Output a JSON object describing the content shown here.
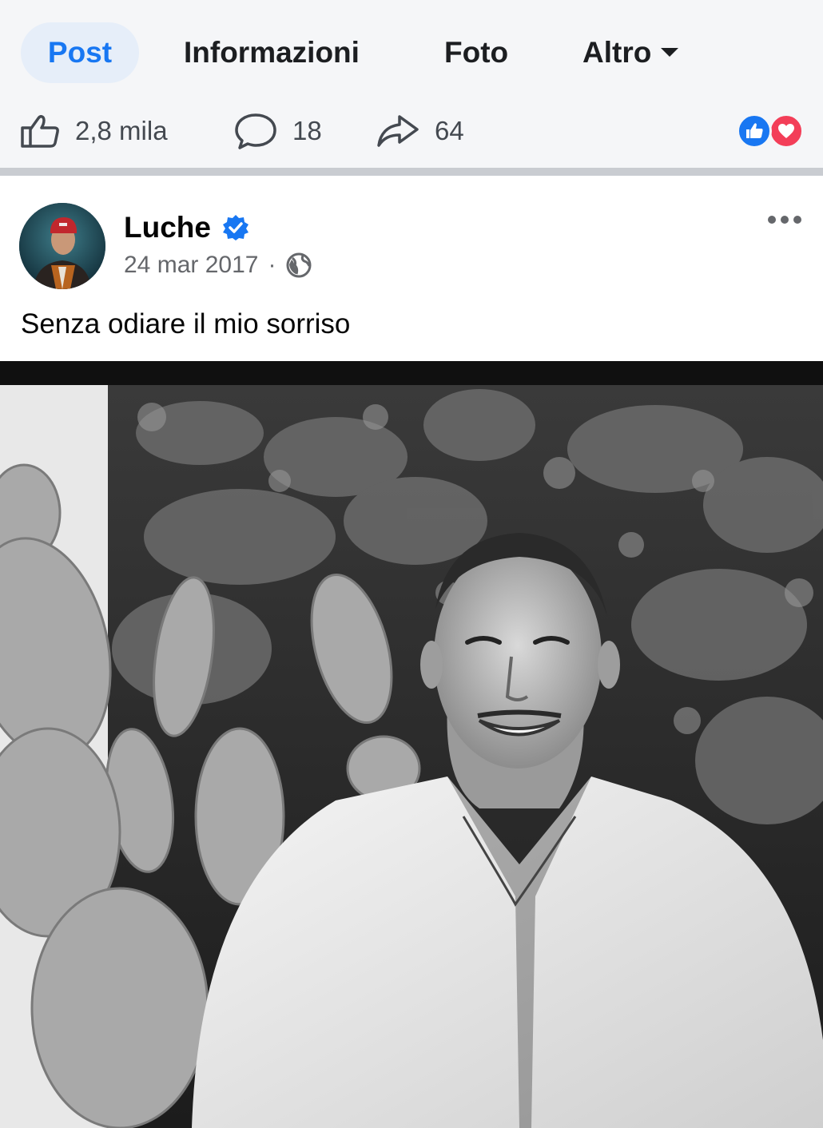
{
  "tabs": {
    "post": "Post",
    "info": "Informazioni",
    "photos": "Foto",
    "more": "Altro"
  },
  "stats": {
    "likes": "2,8 mila",
    "comments": "18",
    "shares": "64"
  },
  "post": {
    "author": "Luche",
    "date": "24 mar 2017",
    "separator": "·",
    "caption": "Senza odiare il mio sorriso"
  },
  "icons": {
    "like": "thumbs-up-outline-icon",
    "comment": "comment-bubble-icon",
    "share": "share-arrow-icon",
    "reaction_like": "like-reaction-icon",
    "reaction_love": "love-reaction-icon",
    "verified": "verified-badge-icon",
    "privacy": "globe-icon",
    "more": "more-options-icon"
  },
  "colors": {
    "accent": "#1877f2",
    "love": "#f33e58",
    "active_tab_bg": "#e6eef9"
  }
}
